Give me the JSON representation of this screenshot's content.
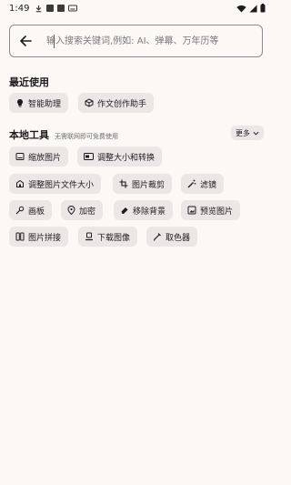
{
  "status_bar": {
    "time": "1:49"
  },
  "search": {
    "placeholder": "输入搜索关键词,例如: AI、弹幕、万年历等",
    "value": ""
  },
  "recent": {
    "title": "最近使用",
    "items": [
      {
        "label": "智能助理",
        "icon": "lightbulb-icon"
      },
      {
        "label": "作文创作助手",
        "icon": "cube-icon"
      }
    ]
  },
  "local_tools": {
    "title": "本地工具",
    "subtitle": "无需联网即可免费使用",
    "more_label": "更多",
    "items": [
      {
        "label": "缩放图片",
        "icon": "image-resize-icon"
      },
      {
        "label": "调整大小和转换",
        "icon": "resize-convert-icon"
      },
      {
        "label": "调整图片文件大小",
        "icon": "file-size-icon"
      },
      {
        "label": "图片裁剪",
        "icon": "crop-icon"
      },
      {
        "label": "滤镜",
        "icon": "magic-wand-icon"
      },
      {
        "label": "画板",
        "icon": "palette-icon"
      },
      {
        "label": "加密",
        "icon": "lock-pin-icon"
      },
      {
        "label": "移除背景",
        "icon": "eraser-icon"
      },
      {
        "label": "预览图片",
        "icon": "image-preview-icon"
      },
      {
        "label": "图片拼接",
        "icon": "stitch-icon"
      },
      {
        "label": "下载图像",
        "icon": "download-image-icon"
      },
      {
        "label": "取色器",
        "icon": "color-picker-icon"
      }
    ]
  }
}
